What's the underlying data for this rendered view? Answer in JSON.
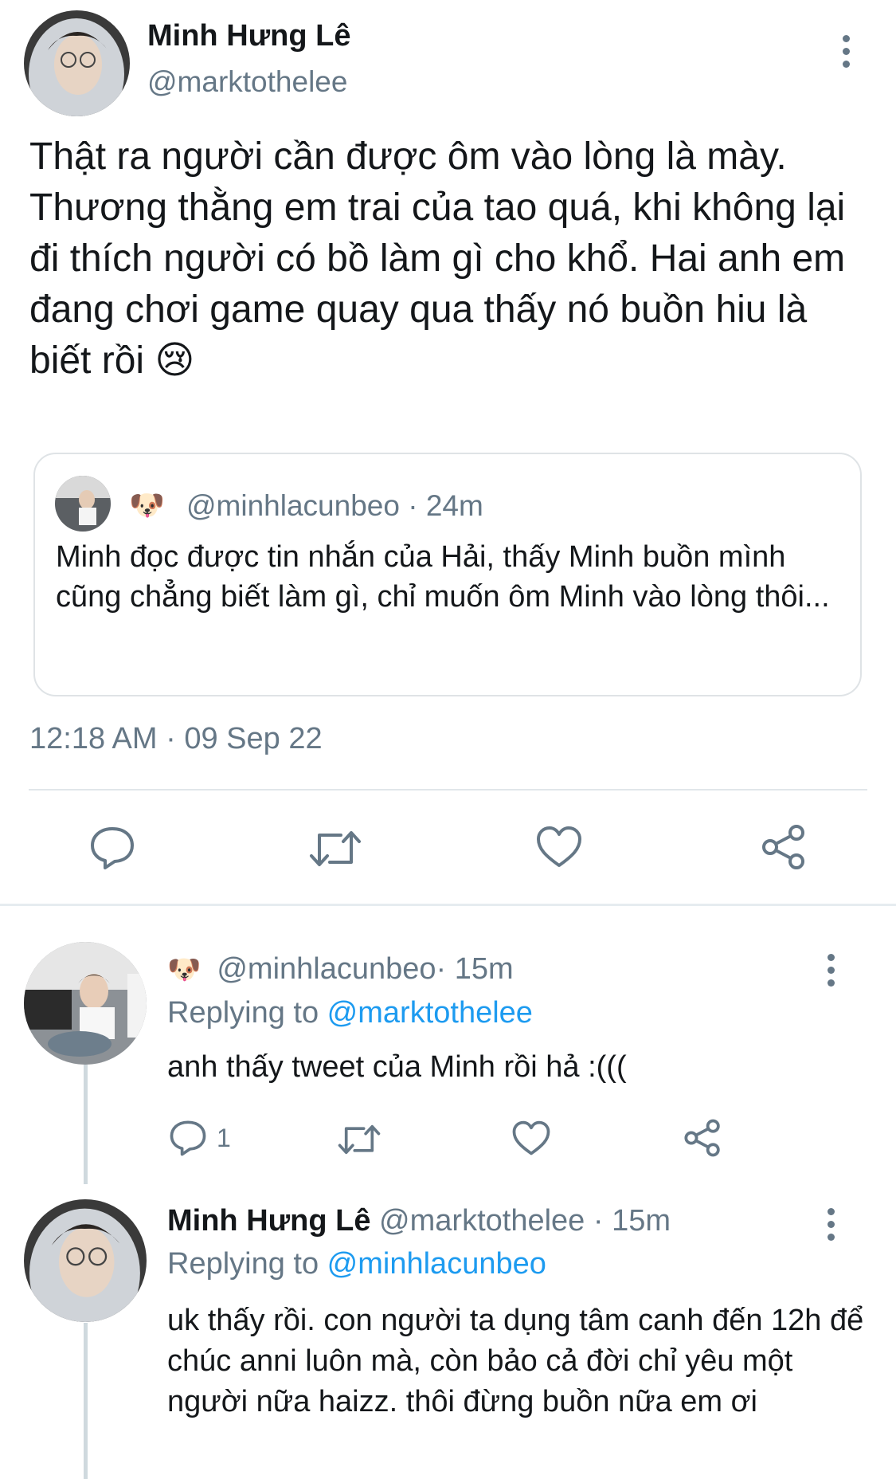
{
  "main_tweet": {
    "author_name": "Minh Hưng Lê",
    "handle": "@marktothelee",
    "text": "Thật ra người cần được ôm vào lòng là mày. Thương thằng em trai của tao quá, khi không lại đi thích người có bồ làm gì cho khổ. Hai anh em đang chơi game quay qua thấy nó buồn hiu là biết rồi 😢",
    "quoted": {
      "handle": "@minhlacunbeo",
      "time": " · 24m",
      "text": "Minh đọc được tin nhắn của Hải, thấy Minh buồn mình cũng chẳng biết làm gì, chỉ muốn ôm Minh vào lòng thôi..."
    },
    "timestamp": "12:18 AM · 09 Sep 22",
    "actions": [
      "reply-icon",
      "retweet-icon",
      "like-icon",
      "share-icon"
    ]
  },
  "replies": [
    {
      "author_name": "",
      "handle": "@minhlacunbeo",
      "time": " · 15m",
      "replying_prefix": "Replying to ",
      "replying_to": "@marktothelee",
      "text": "anh thấy tweet của Minh rồi hả :(((",
      "reply_count": "1"
    },
    {
      "author_name": "Minh Hưng Lê",
      "handle": "@marktothelee",
      "time": " · 15m",
      "replying_prefix": "Replying to ",
      "replying_to": "@minhlacunbeo",
      "text": "uk thấy rồi. con người ta dụng tâm canh đến 12h để chúc anni luôn mà, còn bảo cả đời chỉ yêu một người nữa haizz. thôi đừng buồn nữa em ơi"
    }
  ],
  "colors": {
    "link": "#1d9bf0",
    "muted": "#657786",
    "text": "#14171a",
    "divider": "#e1e6ea"
  }
}
